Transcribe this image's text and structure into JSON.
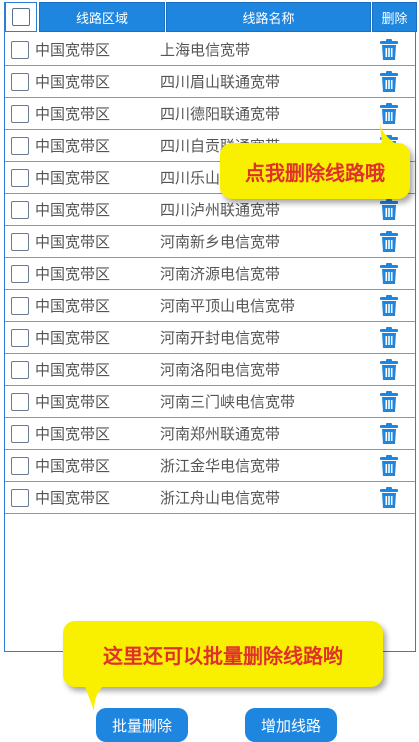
{
  "header": {
    "area": "线路区域",
    "name": "线路名称",
    "delete": "删除"
  },
  "rows": [
    {
      "area": "中国宽带区",
      "name": "上海电信宽带"
    },
    {
      "area": "中国宽带区",
      "name": "四川眉山联通宽带"
    },
    {
      "area": "中国宽带区",
      "name": "四川德阳联通宽带"
    },
    {
      "area": "中国宽带区",
      "name": "四川自贡联通宽带"
    },
    {
      "area": "中国宽带区",
      "name": "四川乐山联通宽带"
    },
    {
      "area": "中国宽带区",
      "name": "四川泸州联通宽带"
    },
    {
      "area": "中国宽带区",
      "name": "河南新乡电信宽带"
    },
    {
      "area": "中国宽带区",
      "name": "河南济源电信宽带"
    },
    {
      "area": "中国宽带区",
      "name": "河南平顶山电信宽带"
    },
    {
      "area": "中国宽带区",
      "name": "河南开封电信宽带"
    },
    {
      "area": "中国宽带区",
      "name": "河南洛阳电信宽带"
    },
    {
      "area": "中国宽带区",
      "name": "河南三门峡电信宽带"
    },
    {
      "area": "中国宽带区",
      "name": "河南郑州联通宽带"
    },
    {
      "area": "中国宽带区",
      "name": "浙江金华电信宽带"
    },
    {
      "area": "中国宽带区",
      "name": "浙江舟山电信宽带"
    }
  ],
  "tips": {
    "delete_line": "点我删除线路哦",
    "batch_delete": "这里还可以批量删除线路哟"
  },
  "buttons": {
    "batch_delete": "批量删除",
    "add_line": "增加线路"
  },
  "colors": {
    "accent": "#1f86e0",
    "tip_bg": "#f9f000",
    "tip_text": "#e0302e"
  },
  "icons": {
    "delete": "trash-icon"
  }
}
